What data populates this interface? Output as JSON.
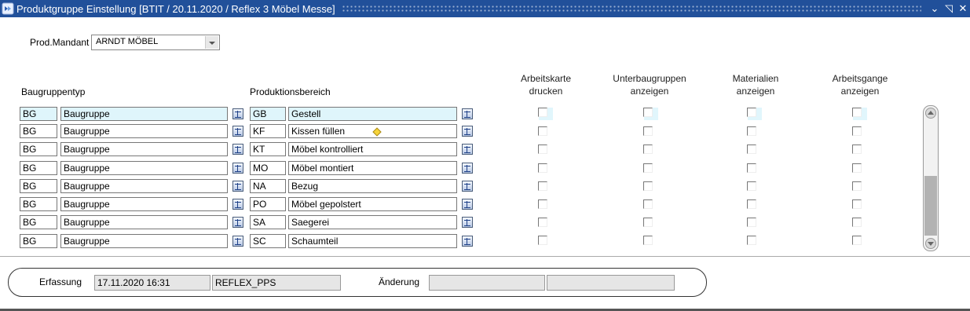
{
  "window": {
    "title": "Produktgruppe Einstellung  [BTIT / 20.11.2020 / Reflex 3 Möbel Messe]",
    "buttons": [
      "minimize",
      "maximize",
      "close"
    ]
  },
  "mandant": {
    "label": "Prod.Mandant",
    "value": "ARNDT MÖBEL"
  },
  "headers": {
    "baugruppentyp": "Baugruppentyp",
    "produktionsbereich": "Produktionsbereich",
    "arbeitskarte": [
      "Arbeitskarte",
      "drucken"
    ],
    "unterbaugruppen": [
      "Unterbaugruppen",
      "anzeigen"
    ],
    "materialien": [
      "Materialien",
      "anzeigen"
    ],
    "arbeitsgange": [
      "Arbeitsgange",
      "anzeigen"
    ]
  },
  "rows": [
    {
      "typ_code": "BG",
      "typ_name": "Baugruppe",
      "bereich_code": "GB",
      "bereich_name": "Gestell"
    },
    {
      "typ_code": "BG",
      "typ_name": "Baugruppe",
      "bereich_code": "KF",
      "bereich_name": "Kissen füllen"
    },
    {
      "typ_code": "BG",
      "typ_name": "Baugruppe",
      "bereich_code": "KT",
      "bereich_name": "Möbel kontrolliert"
    },
    {
      "typ_code": "BG",
      "typ_name": "Baugruppe",
      "bereich_code": "MO",
      "bereich_name": "Möbel montiert"
    },
    {
      "typ_code": "BG",
      "typ_name": "Baugruppe",
      "bereich_code": "NA",
      "bereich_name": "Bezug"
    },
    {
      "typ_code": "BG",
      "typ_name": "Baugruppe",
      "bereich_code": "PO",
      "bereich_name": "Möbel gepolstert"
    },
    {
      "typ_code": "BG",
      "typ_name": "Baugruppe",
      "bereich_code": "SA",
      "bereich_name": "Saegerei"
    },
    {
      "typ_code": "BG",
      "typ_name": "Baugruppe",
      "bereich_code": "SC",
      "bereich_name": "Schaumteil"
    }
  ],
  "checkbox_states": "all unchecked",
  "status": {
    "erfassung_label": "Erfassung",
    "erfassung_datum": "17.11.2020 16:31",
    "erfassung_user": "REFLEX_PPS",
    "aenderung_label": "Änderung",
    "aenderung_datum": "",
    "aenderung_user": ""
  },
  "colors": {
    "titlebar": "#21509a",
    "selected_field": "#dff5fb"
  }
}
